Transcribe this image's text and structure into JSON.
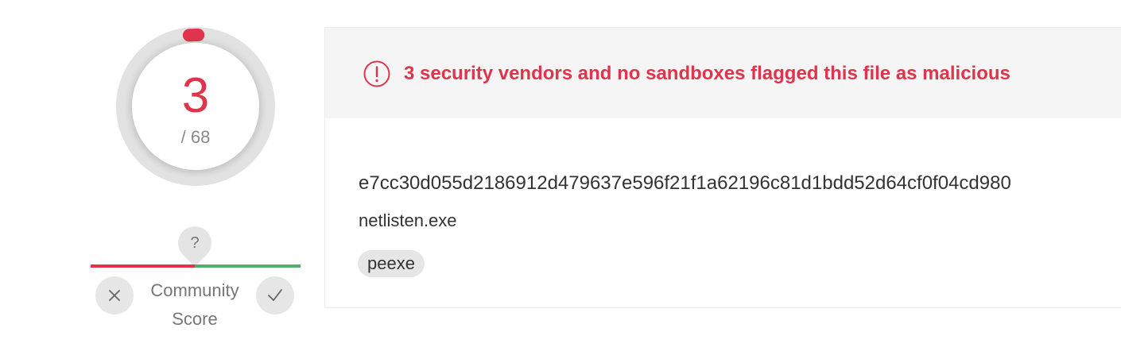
{
  "score": {
    "malicious_count": "3",
    "total_label": "/ 68",
    "malicious": 3,
    "total": 68,
    "accent_color": "#e0344c"
  },
  "community_score": {
    "marker_label": "?",
    "label_line1": "Community",
    "label_line2": "Score",
    "downvote_icon": "close-icon",
    "upvote_icon": "check-icon",
    "negative_color": "#e0344c",
    "positive_color": "#4fb06d"
  },
  "detection": {
    "alert_icon": "exclamation-circle-icon",
    "alert_text": "3 security vendors and no sandboxes flagged this file as malicious",
    "hash": "e7cc30d055d2186912d479637e596f21f1a62196c81d1bdd52d64cf0f04cd980",
    "filename": "netlisten.exe",
    "tags": [
      "peexe"
    ]
  }
}
